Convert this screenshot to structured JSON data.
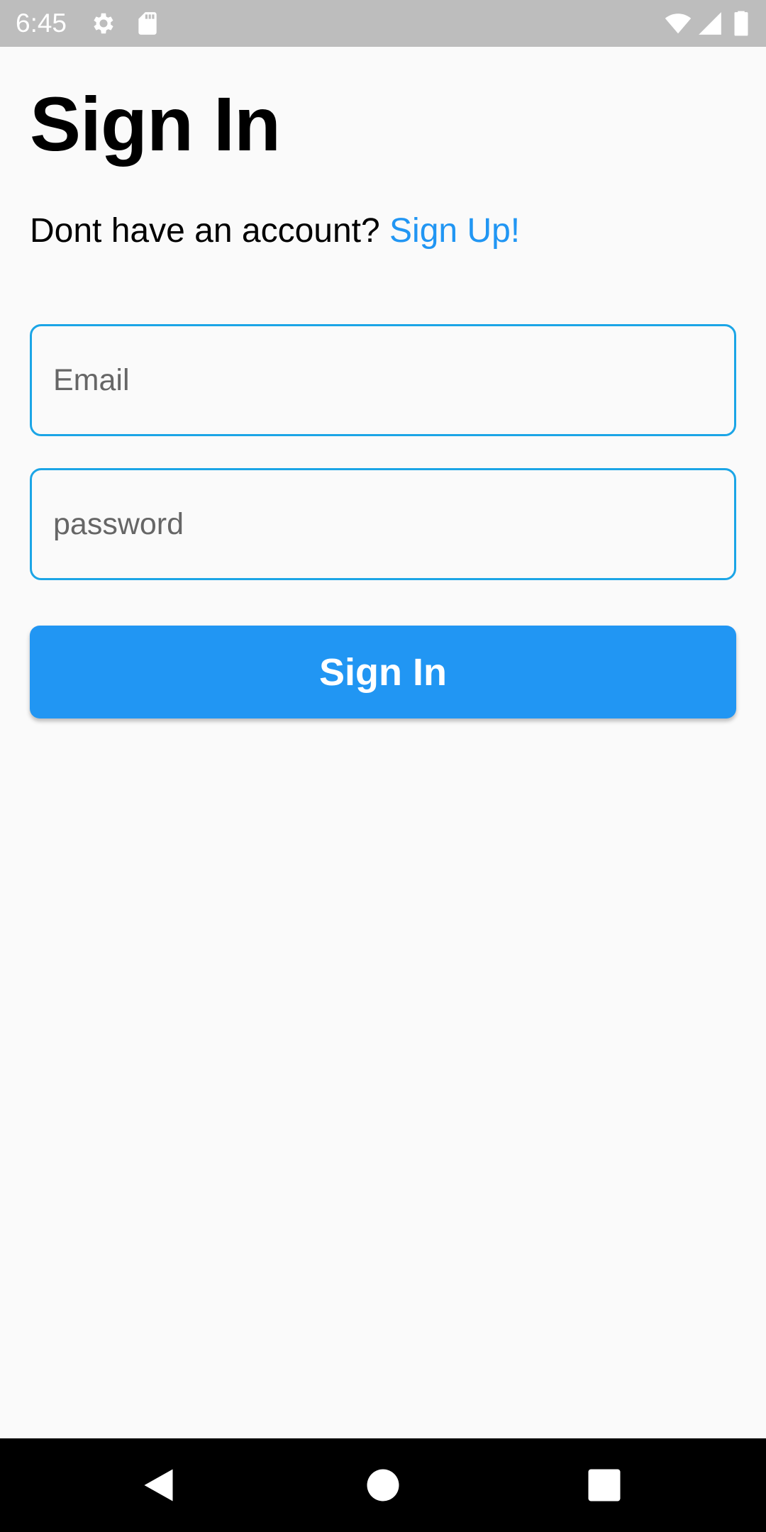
{
  "status_bar": {
    "time": "6:45",
    "icons": [
      "gear-icon",
      "sd-card-icon",
      "wifi-icon",
      "signal-icon",
      "battery-icon"
    ]
  },
  "page": {
    "title": "Sign In",
    "signup_prompt": "Dont have an account? ",
    "signup_link": "Sign Up!"
  },
  "form": {
    "email_placeholder": "Email",
    "email_value": "",
    "password_placeholder": "password",
    "password_value": "",
    "submit_label": "Sign In"
  },
  "nav_bar": {
    "buttons": [
      "back-icon",
      "home-icon",
      "recents-icon"
    ]
  },
  "colors": {
    "accent": "#2196f3",
    "field_border": "#1ba5e6",
    "status_bar": "#bdbdbd",
    "background": "#fafafa"
  }
}
